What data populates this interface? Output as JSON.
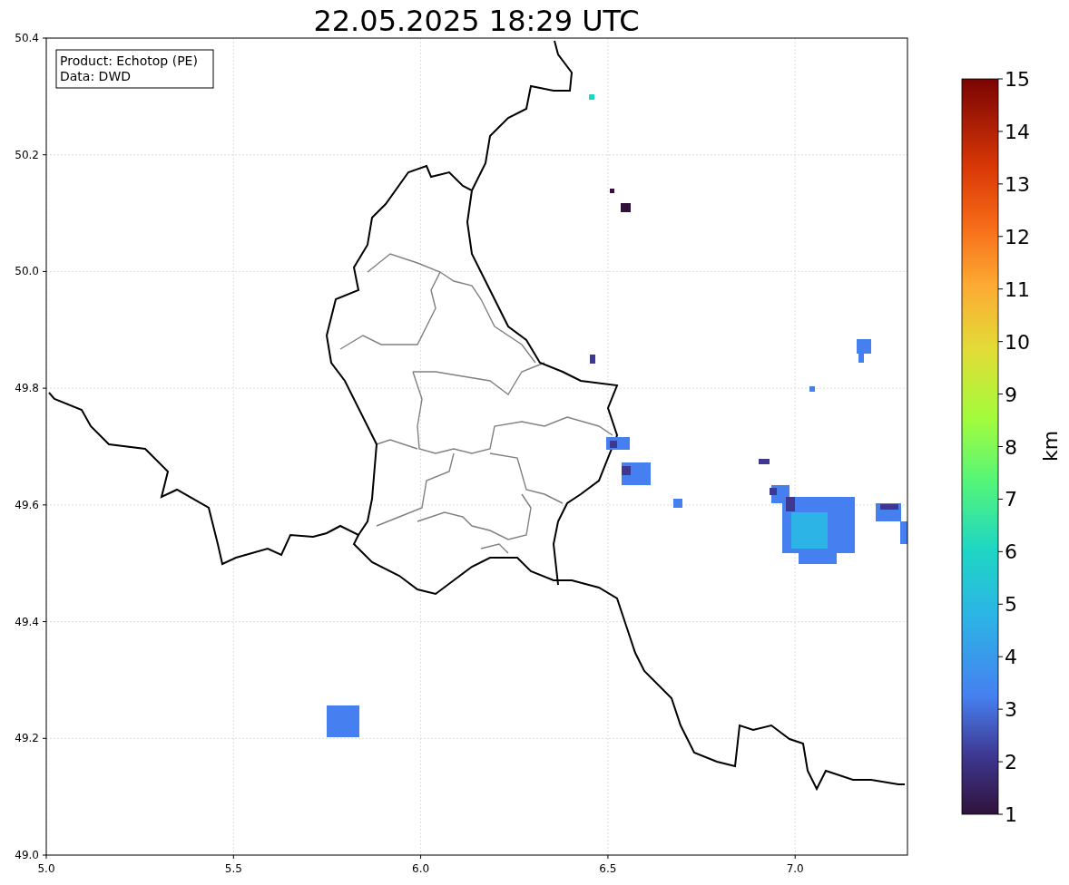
{
  "title": "22.05.2025 18:29 UTC",
  "legend": [
    "Product: Echotop (PE)",
    "Data: DWD"
  ],
  "x_ticks": [
    "5.0",
    "5.5",
    "6.0",
    "6.5",
    "7.0"
  ],
  "y_ticks": [
    "50.4",
    "50.2",
    "50.0",
    "49.8",
    "49.6",
    "49.4",
    "49.2",
    "49.0"
  ],
  "colorbar": {
    "label": "km",
    "ticks": [
      "15",
      "14",
      "13",
      "12",
      "11",
      "10",
      "9",
      "8",
      "7",
      "6",
      "5",
      "4",
      "3",
      "2",
      "1"
    ]
  }
}
